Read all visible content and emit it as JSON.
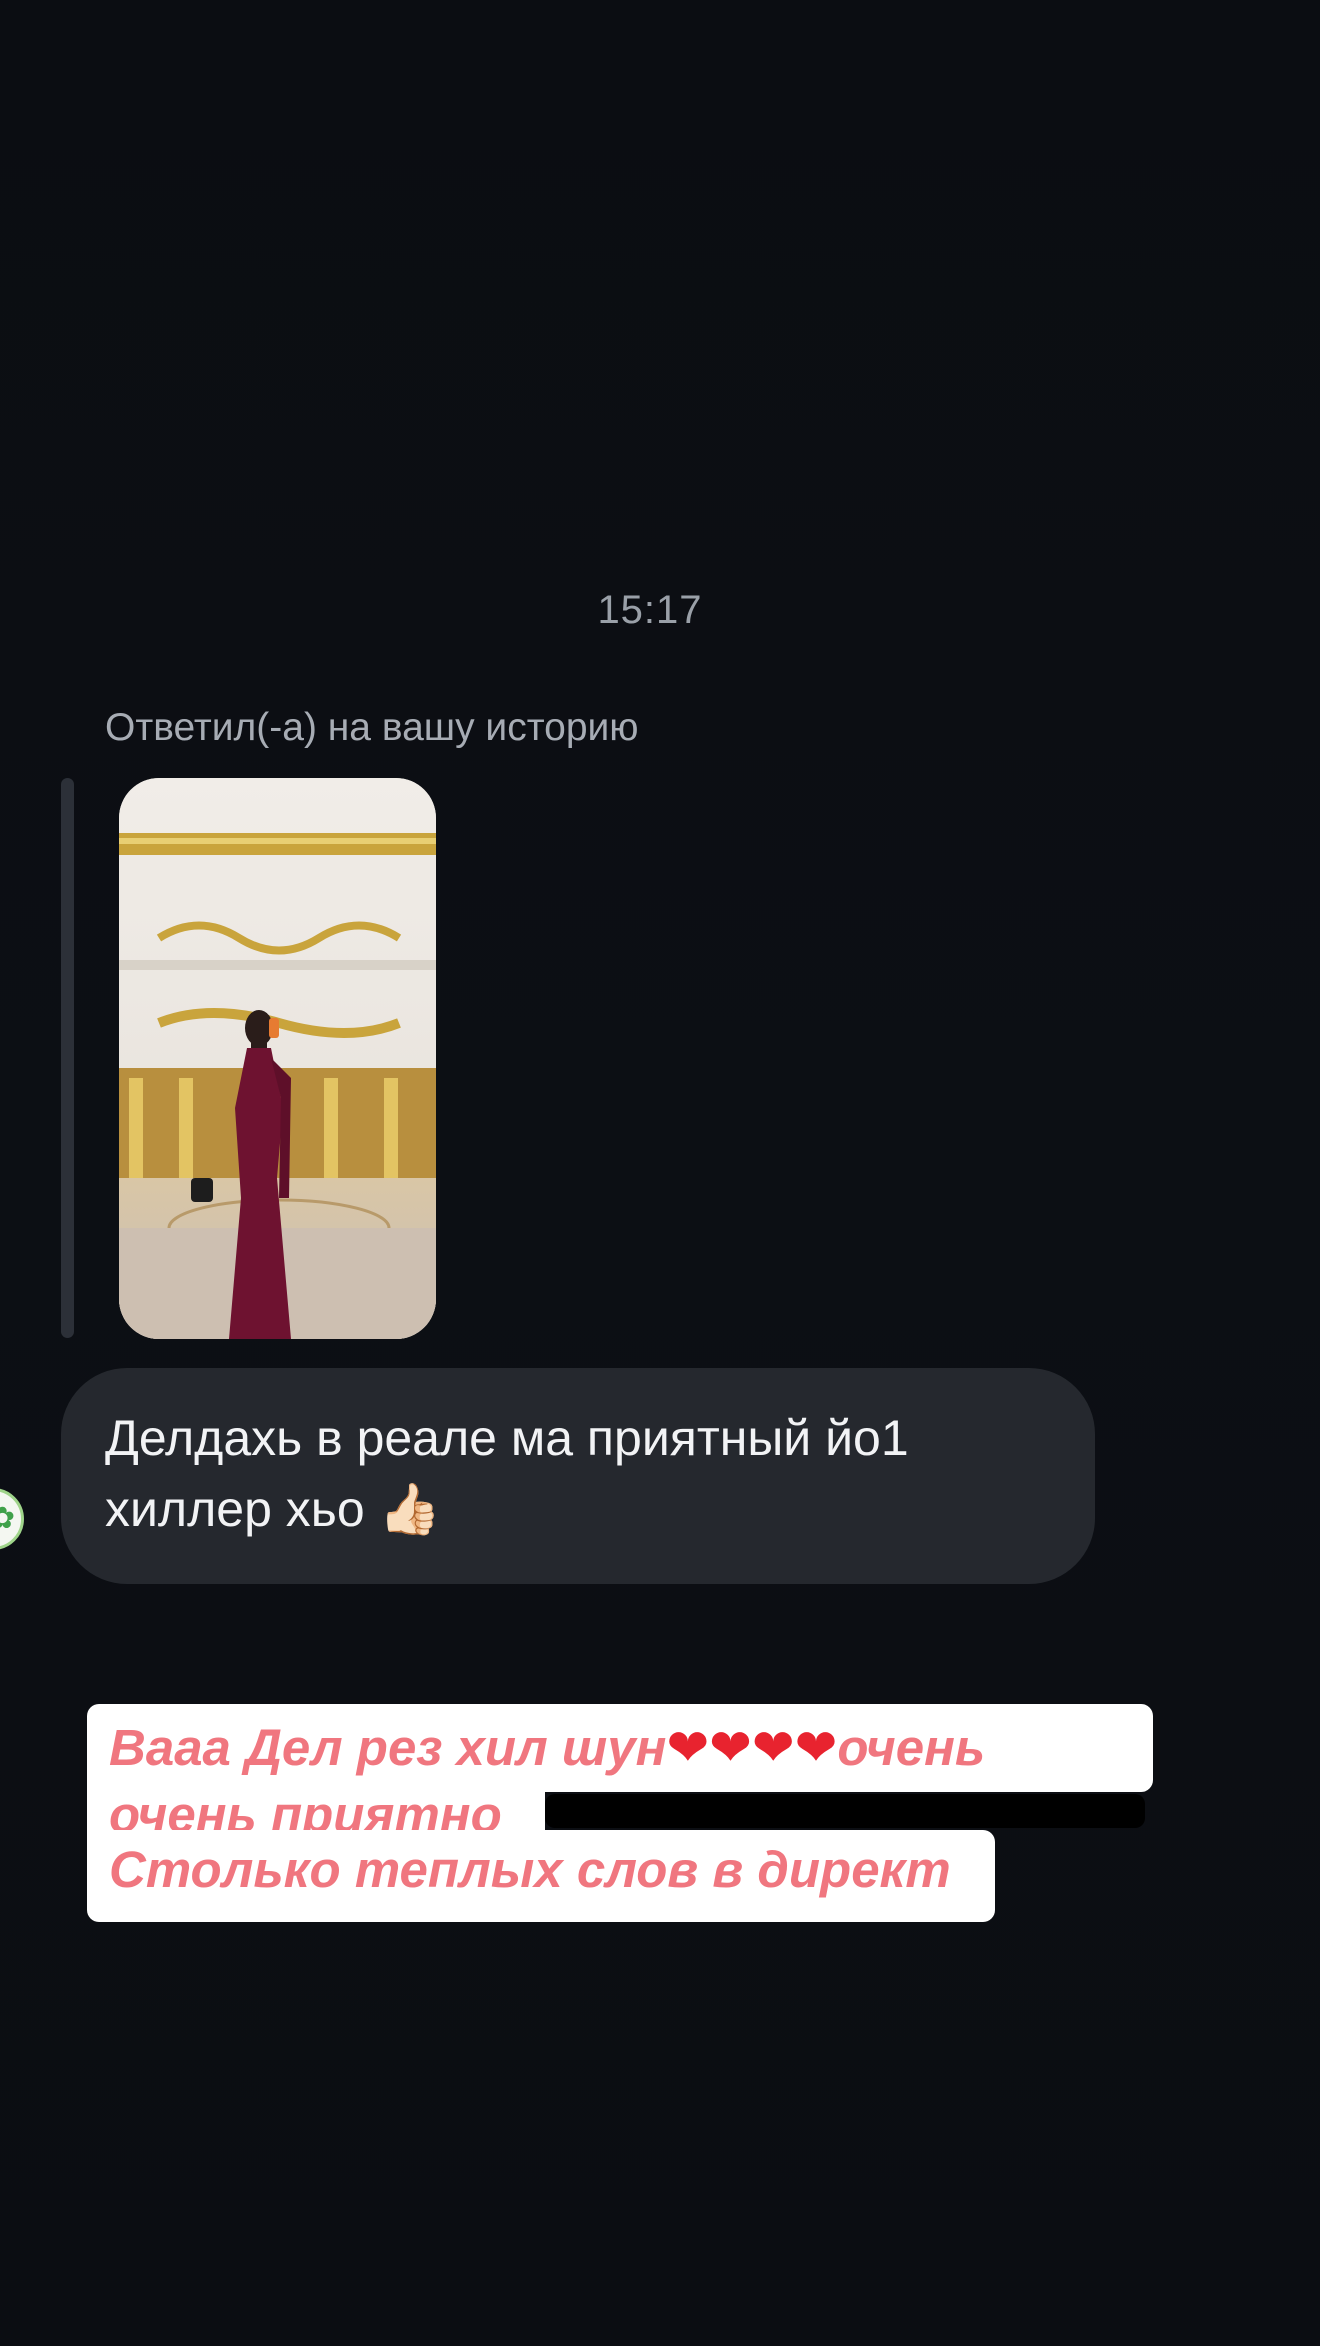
{
  "chat": {
    "timestamp": "15:17",
    "story_reply_caption": "Ответил(-а) на вашу историю",
    "message": {
      "line1": "Делдахь в реале ма приятный йо1",
      "line2": "хиллер хьо",
      "emoji": "👍🏻"
    },
    "sender_avatar_icon": "avatar-icon"
  },
  "story_overlay": {
    "line1_prefix": "Ваaa Дел рез хил шун",
    "hearts": "❤❤❤❤",
    "line1_suffix": "очень",
    "line2": "очень приятно",
    "line3": "Столько теплых слов в директ",
    "text_color": "#f0767f",
    "heart_color": "#e8232f"
  },
  "colors": {
    "background": "#0c0e13",
    "bubble": "#25282e",
    "redaction": "#000000"
  }
}
